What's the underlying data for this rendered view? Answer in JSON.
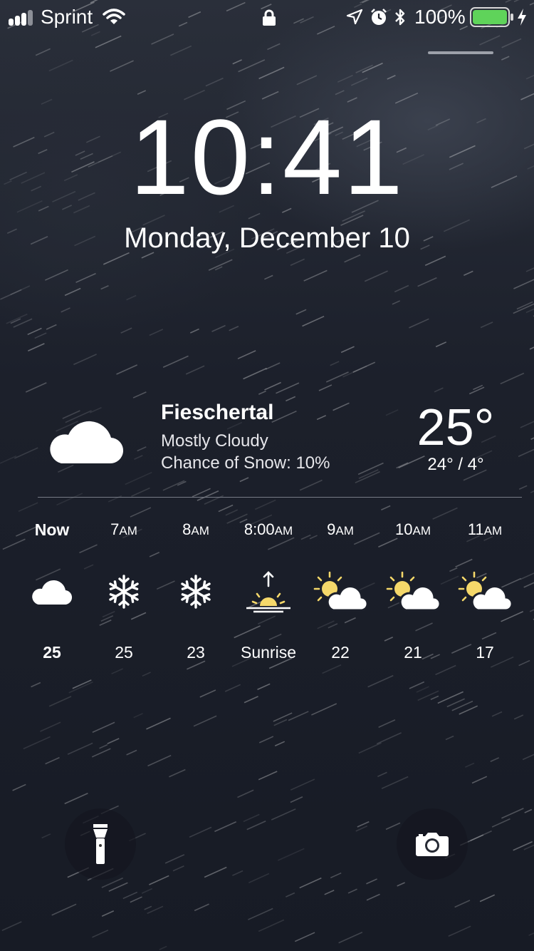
{
  "status_bar": {
    "carrier": "Sprint",
    "battery_percent": "100%",
    "battery_level": 1.0,
    "icons": [
      "signal-icon",
      "wifi-icon",
      "lock-icon",
      "location-icon",
      "alarm-icon",
      "bluetooth-icon",
      "battery-icon",
      "charging-icon"
    ]
  },
  "lock_screen": {
    "time": "10:41",
    "date": "Monday, December 10"
  },
  "weather": {
    "location": "Fieschertal",
    "condition": "Mostly Cloudy",
    "snow_chance": "Chance of Snow: 10%",
    "temperature": "25°",
    "high_low": "24° / 4°",
    "main_icon": "cloud-icon",
    "hourly": [
      {
        "label": "Now",
        "ampm": "",
        "icon": "cloud-icon",
        "temp": "25"
      },
      {
        "label": "7",
        "ampm": "AM",
        "icon": "snowflake-icon",
        "temp": "25"
      },
      {
        "label": "8",
        "ampm": "AM",
        "icon": "snowflake-icon",
        "temp": "23"
      },
      {
        "label": "8:00",
        "ampm": "AM",
        "icon": "sunrise-icon",
        "temp": "Sunrise"
      },
      {
        "label": "9",
        "ampm": "AM",
        "icon": "partly-sunny-icon",
        "temp": "22"
      },
      {
        "label": "10",
        "ampm": "AM",
        "icon": "partly-sunny-icon",
        "temp": "21"
      },
      {
        "label": "11",
        "ampm": "AM",
        "icon": "partly-sunny-icon",
        "temp": "17"
      }
    ]
  },
  "colors": {
    "sun_yellow": "#f5d86a",
    "battery_green": "#5fd35a"
  },
  "actions": {
    "flashlight": "flashlight-icon",
    "camera": "camera-icon"
  }
}
